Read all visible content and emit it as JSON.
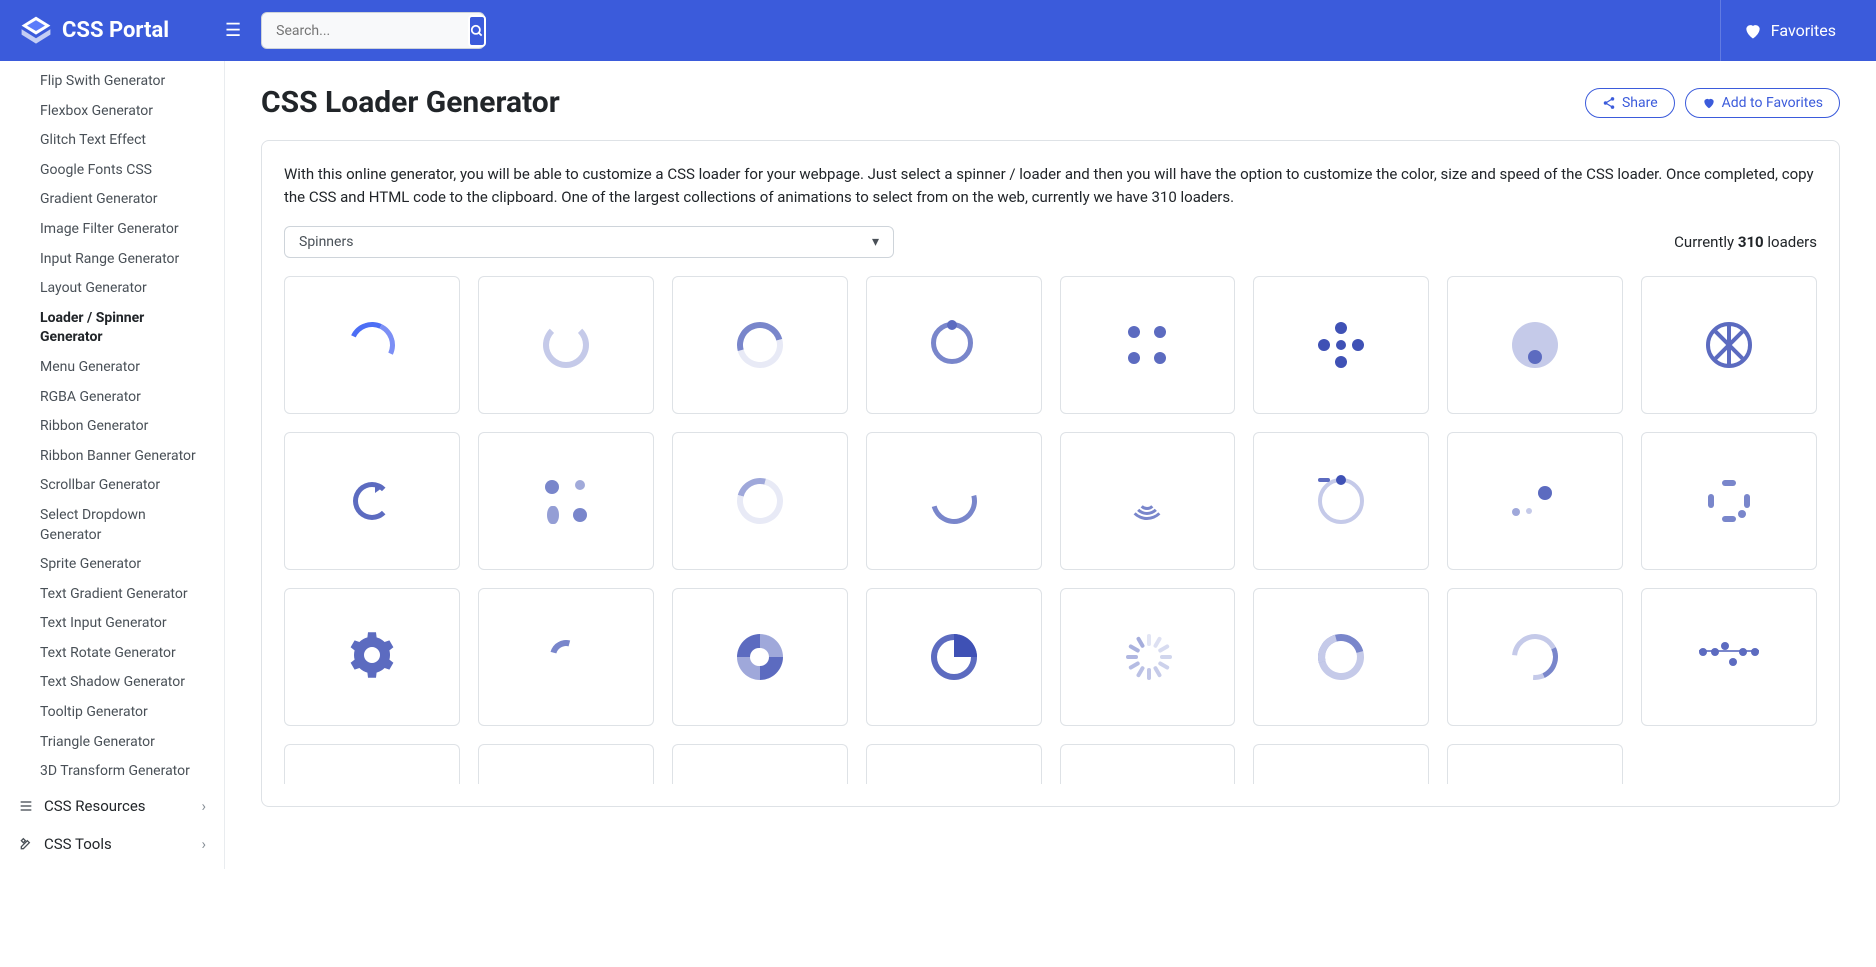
{
  "brand": "CSS Portal",
  "search": {
    "placeholder": "Search..."
  },
  "favorites_label": "Favorites",
  "sidebar": {
    "items": [
      {
        "label": "Flip Swith Generator"
      },
      {
        "label": "Flexbox Generator"
      },
      {
        "label": "Glitch Text Effect"
      },
      {
        "label": "Google Fonts CSS"
      },
      {
        "label": "Gradient Generator"
      },
      {
        "label": "Image Filter Generator"
      },
      {
        "label": "Input Range Generator"
      },
      {
        "label": "Layout Generator"
      },
      {
        "label": "Loader / Spinner Generator",
        "active": true
      },
      {
        "label": "Menu Generator"
      },
      {
        "label": "RGBA Generator"
      },
      {
        "label": "Ribbon Generator"
      },
      {
        "label": "Ribbon Banner Generator"
      },
      {
        "label": "Scrollbar Generator"
      },
      {
        "label": "Select Dropdown Generator"
      },
      {
        "label": "Sprite Generator"
      },
      {
        "label": "Text Gradient Generator"
      },
      {
        "label": "Text Input Generator"
      },
      {
        "label": "Text Rotate Generator"
      },
      {
        "label": "Text Shadow Generator"
      },
      {
        "label": "Tooltip Generator"
      },
      {
        "label": "Triangle Generator"
      },
      {
        "label": "3D Transform Generator"
      }
    ],
    "sections": [
      {
        "label": "CSS Resources"
      },
      {
        "label": "CSS Tools"
      }
    ]
  },
  "page": {
    "title": "CSS Loader Generator",
    "share": "Share",
    "add_fav": "Add to Favorites",
    "intro": "With this online generator, you will be able to customize a CSS loader for your webpage. Just select a spinner / loader and then you will have the option to customize the color, size and speed of the CSS loader. Once completed, copy the CSS and HTML code to the clipboard. One of the largest collections of animations to select from on the web, currently we have 310 loaders.",
    "dropdown_value": "Spinners",
    "count_prefix": "Currently ",
    "count_num": "310",
    "count_suffix": " loaders"
  }
}
